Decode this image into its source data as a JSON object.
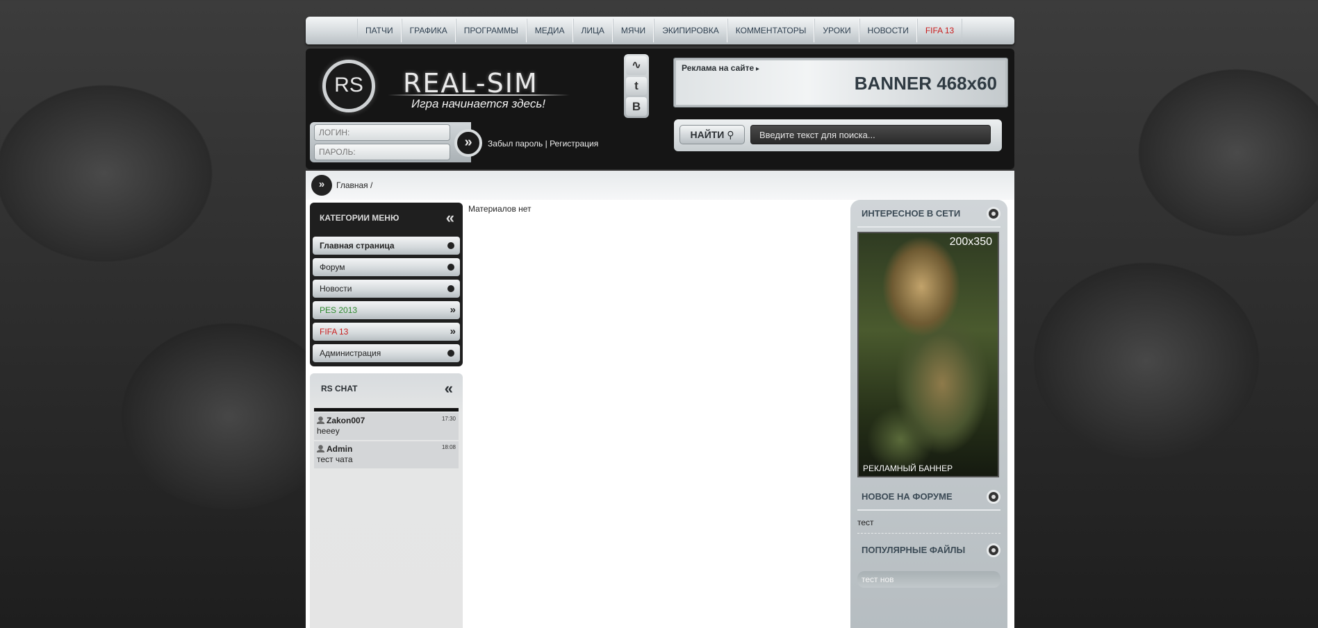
{
  "nav": {
    "items": [
      "ПАТЧИ",
      "ГРАФИКА",
      "ПРОГРАММЫ",
      "МЕДИА",
      "ЛИЦА",
      "МЯЧИ",
      "ЭКИПИРОВКА",
      "КОММЕНТАТОРЫ",
      "УРОКИ",
      "НОВОСТИ"
    ],
    "highlight": "FIFA 13",
    "highlight_color": "#c91d1d"
  },
  "header": {
    "logo_mark": "RS",
    "logo_title": "REAL-SIM",
    "logo_subtitle": "Игра начинается здесь!",
    "social": [
      "rss-icon",
      "tumblr-icon",
      "vk-icon"
    ],
    "social_glyphs": [
      "∿",
      "t",
      "B"
    ],
    "ad_label": "Реклама на сайте",
    "ad_size": "BANNER 468x60"
  },
  "login": {
    "login_placeholder": "ЛОГИН:",
    "password_placeholder": "ПАРОЛЬ:",
    "forgot": "Забыл пароль",
    "sep": " | ",
    "register": "Регистрация"
  },
  "search": {
    "button": "НАЙТИ",
    "placeholder": "Введите текст для поиска..."
  },
  "breadcrumb": {
    "text": "Главная /"
  },
  "sidebar": {
    "categories_title": "КАТЕГОРИИ МЕНЮ",
    "items": [
      {
        "label": "Главная страница"
      },
      {
        "label": "Форум"
      },
      {
        "label": "Новости"
      },
      {
        "label": "PES 2013",
        "color": "#2f8a2f"
      },
      {
        "label": "FIFA 13",
        "color": "#c91d1d"
      },
      {
        "label": "Администрация"
      }
    ],
    "chat_title": "RS CHAT",
    "chat": [
      {
        "user": "Zakon007",
        "time": "17:30",
        "text": "heeey"
      },
      {
        "user": "Admin",
        "time": "18:08",
        "text": "тест чата"
      }
    ]
  },
  "main": {
    "empty_text": "Материалов нет"
  },
  "right": {
    "interesting_title": "ИНТЕРЕСНОЕ В СЕТИ",
    "ad_size": "200x350",
    "ad_caption": "РЕКЛАМНЫЙ БАННЕР",
    "forum_title": "НОВОЕ НА ФОРУМЕ",
    "forum_item": "тест",
    "files_title": "ПОПУЛЯРНЫЕ ФАЙЛЫ",
    "file_item": "тест нов"
  }
}
